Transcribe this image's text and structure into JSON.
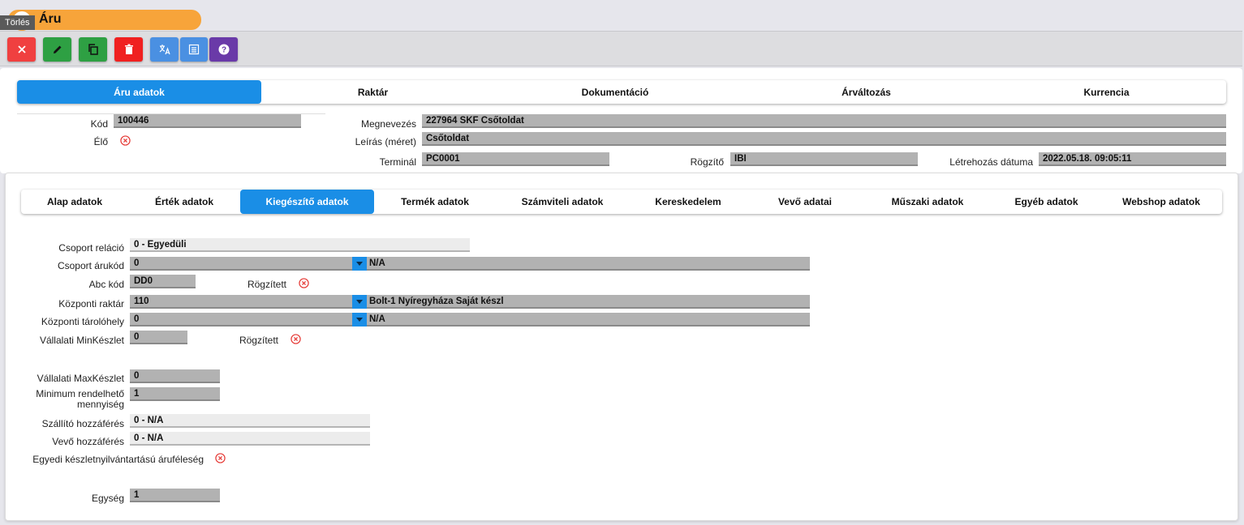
{
  "window": {
    "title": "Áru",
    "tooltip": "Törlés"
  },
  "toolbar": {
    "buttons": [
      {
        "name": "close-button",
        "icon": "close-icon",
        "color": "#f04040"
      },
      {
        "name": "edit-button",
        "icon": "pencil-icon",
        "color": "#2ea043"
      },
      {
        "name": "copy-button",
        "icon": "copy-icon",
        "color": "#2ea043"
      },
      {
        "name": "delete-button",
        "icon": "trash-icon",
        "color": "#f02020"
      },
      {
        "name": "translate-button",
        "icon": "translate-icon",
        "color": "#4a90e2"
      },
      {
        "name": "list-button",
        "icon": "list-icon",
        "color": "#4a90e2"
      },
      {
        "name": "help-button",
        "icon": "help-icon",
        "color": "#6a3aa8"
      }
    ]
  },
  "top_tabs": [
    "Áru adatok",
    "Raktár",
    "Dokumentáció",
    "Árváltozás",
    "Kurrencia"
  ],
  "header": {
    "kod_label": "Kód",
    "kod": "100446",
    "elo_label": "Élő",
    "megnevezes_label": "Megnevezés",
    "megnevezes": "227964 SKF Csőtoldat",
    "leiras_label": "Leírás (méret)",
    "leiras": "Csőtoldat",
    "terminal_label": "Terminál",
    "terminal": "PC0001",
    "rogzito_label": "Rögzítő",
    "rogzito": "IBI",
    "letrehozas_label": "Létrehozás dátuma",
    "letrehozas": "2022.05.18. 09:05:11"
  },
  "sub_tabs": [
    "Alap adatok",
    "Érték adatok",
    "Kiegészítő adatok",
    "Termék adatok",
    "Számviteli adatok",
    "Kereskedelem",
    "Vevő adatai",
    "Műszaki adatok",
    "Egyéb adatok",
    "Webshop adatok"
  ],
  "form": {
    "csoport_relacio_label": "Csoport reláció",
    "csoport_relacio": "0 - Egyedüli",
    "csoport_arukod_label": "Csoport árukód",
    "csoport_arukod": "0",
    "csoport_arukod_name": "N/A",
    "abc_kod_label": "Abc kód",
    "abc_kod": "DD0",
    "rogzitett_label": "Rögzített",
    "kozponti_raktar_label": "Központi raktár",
    "kozponti_raktar": "110",
    "kozponti_raktar_name": "Bolt-1 Nyíregyháza Saját készl",
    "kozponti_tarolohely_label": "Központi tárolóhely",
    "kozponti_tarolohely": "0",
    "kozponti_tarolohely_name": "N/A",
    "min_keszlet_label": "Vállalati MinKészlet",
    "min_keszlet": "0",
    "rogzitett2_label": "Rögzített",
    "max_keszlet_label": "Vállalati MaxKészlet",
    "max_keszlet": "0",
    "min_rendelheto_label_1": "Minimum rendelhető",
    "min_rendelheto_label_2": "mennyiség",
    "min_rendelheto": "1",
    "szallito_label": "Szállító hozzáférés",
    "szallito": "0 - N/A",
    "vevo_label": "Vevő hozzáférés",
    "vevo": "0 - N/A",
    "egyedi_label": "Egyedi készletnyilvántartású áruféleség",
    "egyseg_label": "Egység",
    "egyseg": "1"
  }
}
